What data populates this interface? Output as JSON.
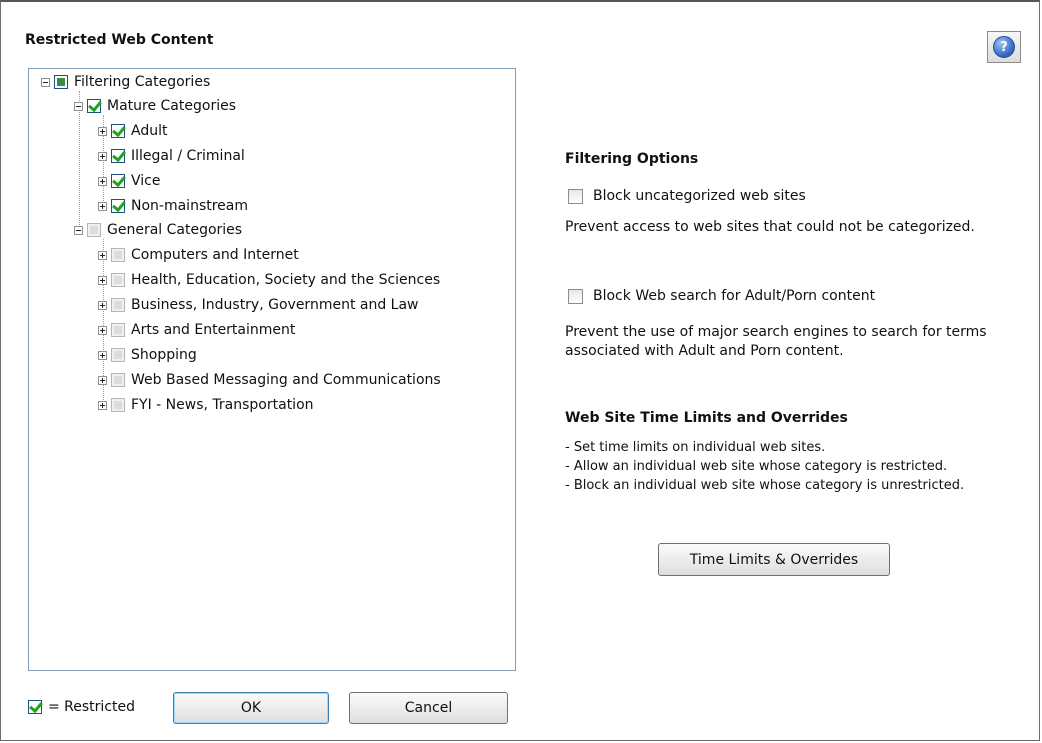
{
  "dialog": {
    "title": "Restricted Web Content",
    "help_symbol": "?"
  },
  "tree": {
    "root": "Filtering Categories",
    "mature": {
      "label": "Mature Categories",
      "children": [
        "Adult",
        "Illegal / Criminal",
        "Vice",
        "Non-mainstream"
      ]
    },
    "general": {
      "label": "General Categories",
      "children": [
        "Computers and Internet",
        "Health, Education, Society and the Sciences",
        "Business, Industry, Government and Law",
        "Arts and Entertainment",
        "Shopping",
        "Web Based Messaging and Communications",
        "FYI - News, Transportation"
      ]
    }
  },
  "options": {
    "heading": "Filtering Options",
    "block_uncategorized": {
      "label": "Block uncategorized web sites",
      "checked": false,
      "description": "Prevent access to web sites that could not be categorized."
    },
    "block_search": {
      "label": "Block Web search for Adult/Porn content",
      "checked": false,
      "description_line1": "Prevent the use of major search engines to search for terms",
      "description_line2": "associated with Adult and Porn content."
    }
  },
  "time_limits": {
    "heading": "Web Site Time Limits and Overrides",
    "bullets": [
      "- Set time limits on individual web sites.",
      "- Allow an individual web site whose category is restricted.",
      "- Block an individual web site whose category is unrestricted."
    ],
    "button": "Time Limits & Overrides"
  },
  "footer": {
    "legend": "= Restricted",
    "ok": "OK",
    "cancel": "Cancel"
  },
  "colors": {
    "check_green": "#21a121",
    "tree_border": "#7f9db9",
    "help_blue": "#2f63bf"
  }
}
